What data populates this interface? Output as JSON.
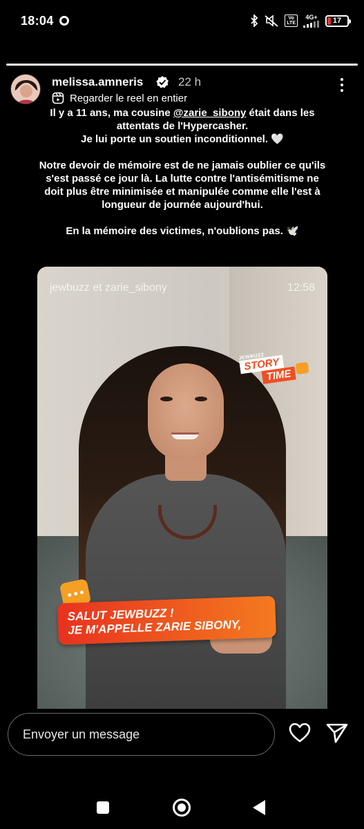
{
  "status_bar": {
    "time": "18:04",
    "volte": "Vo\nLTE",
    "network": "4G+",
    "battery_level": "17",
    "battery_fraction": 0.17,
    "icons": [
      "whatsapp-notification-icon",
      "bluetooth-icon",
      "mute-icon",
      "signal-icon"
    ]
  },
  "story": {
    "progress_fraction": 1.0,
    "username": "melissa.amneris",
    "verified": true,
    "time_ago": "22 h",
    "reel_link": "Regarder le reel en entier",
    "caption": {
      "p1_before": "Il y a 11 ans, ma cousine ",
      "p1_mention": "@zarie_sibony",
      "p1_after": " était dans les attentats de l'Hypercasher.",
      "p1_line2": "Je lui porte un soutien inconditionnel. 🤍",
      "p2": "Notre devoir de mémoire est de ne jamais oublier ce qu'ils s'est passé ce jour là. La lutte contre l'antisémitisme ne doit plus être minimisée et manipulée comme elle l'est à longueur de journée aujourd'hui.",
      "p3": "En la mémoire des victimes, n'oublions pas. 🕊️"
    }
  },
  "reel": {
    "authors": "jewbuzz et zarie_sibony",
    "duration": "12:58",
    "badge_small": "JEWBUZZ",
    "badge_line1": "STORY",
    "badge_line2": "TIME",
    "subtitle_line1": "SALUT JEWBUZZ !",
    "subtitle_line2": "JE M'APPELLE ZARIE SIBONY,"
  },
  "composer": {
    "placeholder": "Envoyer un message"
  }
}
